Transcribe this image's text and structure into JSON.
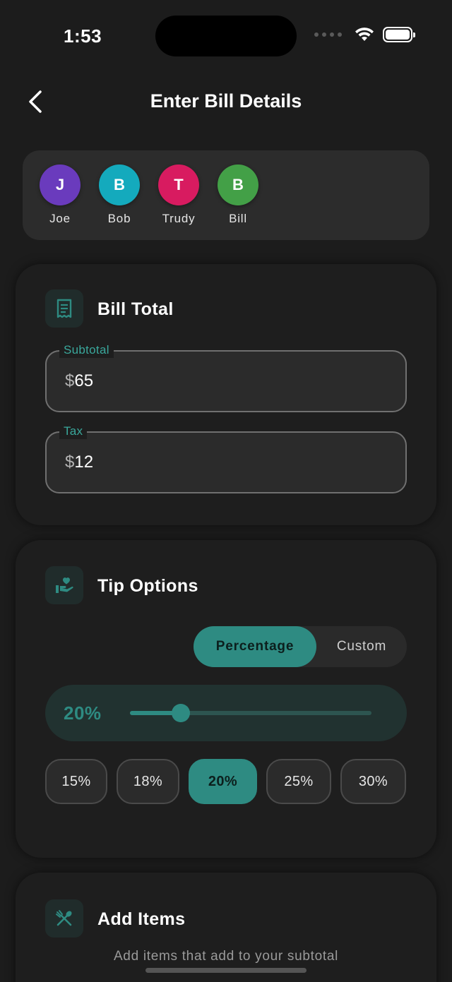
{
  "status_bar": {
    "time": "1:53"
  },
  "header": {
    "title": "Enter Bill Details"
  },
  "participants": [
    {
      "initial": "J",
      "name": "Joe",
      "color": "#6a3bbd"
    },
    {
      "initial": "B",
      "name": "Bob",
      "color": "#14aabd"
    },
    {
      "initial": "T",
      "name": "Trudy",
      "color": "#d81b60"
    },
    {
      "initial": "B",
      "name": "Bill",
      "color": "#43a047"
    }
  ],
  "bill_total": {
    "title": "Bill Total",
    "subtotal": {
      "label": "Subtotal",
      "currency": "$",
      "value": "65"
    },
    "tax": {
      "label": "Tax",
      "currency": "$",
      "value": "12"
    }
  },
  "tip_options": {
    "title": "Tip Options",
    "mode": {
      "active": "Percentage",
      "inactive": "Custom"
    },
    "slider": {
      "label": "20%",
      "fraction": 0.21
    },
    "presets": [
      "15%",
      "18%",
      "20%",
      "25%",
      "30%"
    ],
    "selected_preset": "20%"
  },
  "add_items": {
    "title": "Add Items",
    "subtitle": "Add items that add to your subtotal"
  },
  "colors": {
    "accent": "#2e8b82",
    "background": "#1c1c1c",
    "label": "#3aa89c"
  }
}
